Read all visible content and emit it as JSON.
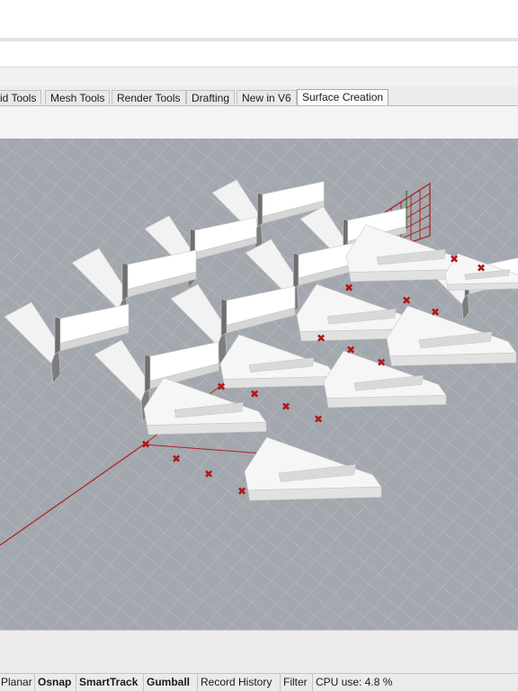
{
  "tabs": [
    {
      "label": "id Tools",
      "active": false
    },
    {
      "label": "Mesh Tools",
      "active": false
    },
    {
      "label": "Render Tools",
      "active": false
    },
    {
      "label": "Drafting",
      "active": false
    },
    {
      "label": "New in V6",
      "active": false
    },
    {
      "label": "Surface Creation",
      "active": true
    }
  ],
  "viewport": {
    "background_color": "#a3a7ae",
    "grid_color": "#b3b7bd",
    "axis_colors": {
      "x": "#b02020",
      "y": "#2e8b2e"
    },
    "control_point_color": "#b01818"
  },
  "status": {
    "planar": "Planar",
    "osnap": "Osnap",
    "smarttrack": "SmartTrack",
    "gumball": "Gumball",
    "record_history": "Record History",
    "filter": "Filter",
    "cpu_usage": "CPU use: 4.8 %"
  }
}
